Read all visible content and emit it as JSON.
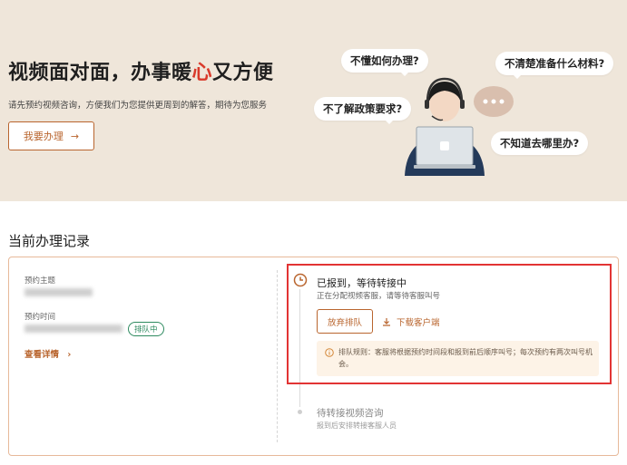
{
  "hero": {
    "title_pre": "视频面对面，办事暖",
    "title_heart": "心",
    "title_post": "又方便",
    "subtitle": "请先预约视频咨询，方便我们为您提供更周到的解答，期待为您服务",
    "cta_label": "我要办理",
    "cta_arrow": "→",
    "bubbles": [
      "不懂如何办理?",
      "不清楚准备什么材料?",
      "不了解政策要求?",
      "不知道去哪里办?"
    ]
  },
  "section": {
    "title": "当前办理记录"
  },
  "record": {
    "topic_label": "预约主题",
    "time_label": "预约时间",
    "status_badge": "排队中",
    "detail_label": "查看详情",
    "detail_arrow": "›"
  },
  "steps": {
    "current": {
      "title": "已报到，等待转接中",
      "subtitle": "正在分配视频客服，请等待客服叫号",
      "giveup_label": "放弃排队",
      "download_label": "下载客户端",
      "notice": "排队规则：客服将根据预约时间段和报到前后顺序叫号；每次预约有两次叫号机会。"
    },
    "next": {
      "title": "待转接视频咨询",
      "subtitle": "报到后安排转接客服人员"
    }
  },
  "icons": [
    "arrow-right-icon",
    "clock-icon",
    "download-icon",
    "info-icon",
    "chevron-right-icon"
  ],
  "colors": {
    "accent": "#b9652e",
    "hero_bg": "#efe6da",
    "highlight": "#e23434",
    "badge_green": "#2e8a5f"
  }
}
